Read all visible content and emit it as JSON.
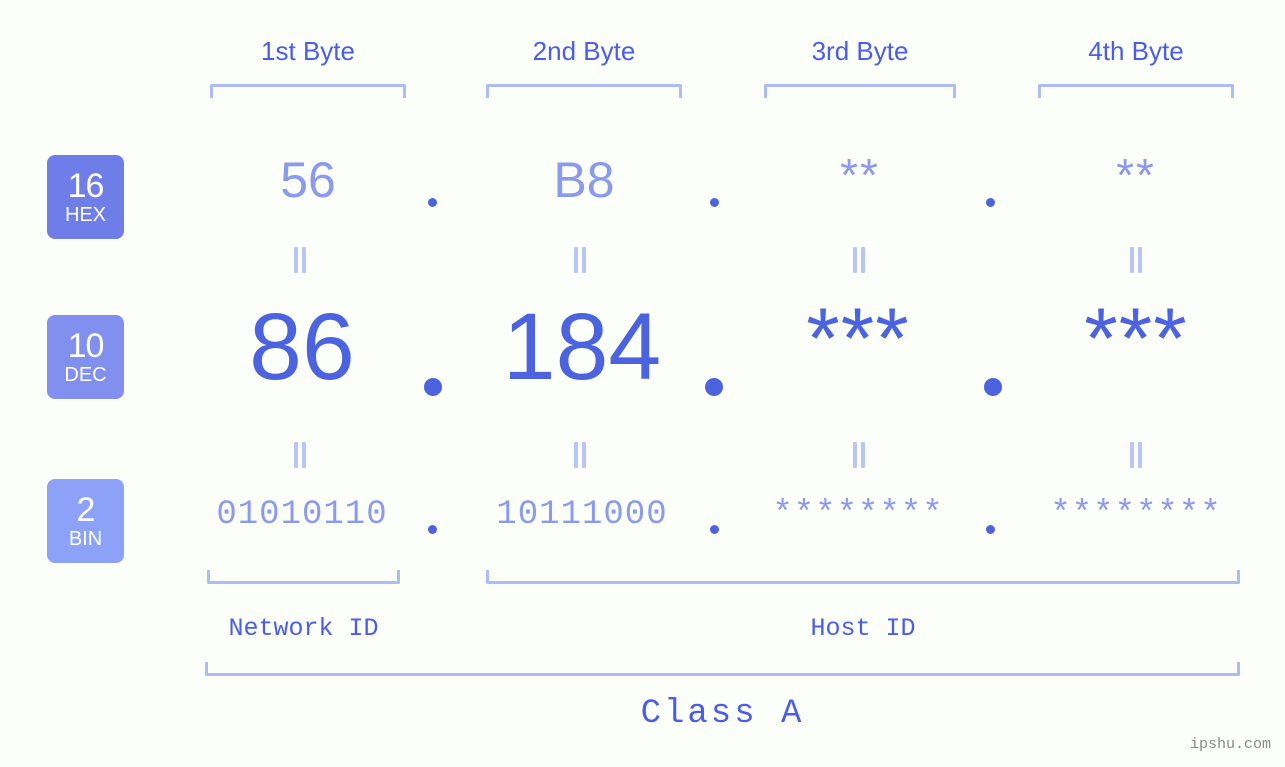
{
  "meta": {
    "watermark": "ipshu.com",
    "background_color": "#fcfef9",
    "accent_color": "#4c63e0",
    "accent_light_color": "#8a9aee",
    "bracket_color": "#aebcf6"
  },
  "byte_headers": [
    {
      "label": "1st Byte"
    },
    {
      "label": "2nd Byte"
    },
    {
      "label": "3rd Byte"
    },
    {
      "label": "4th Byte"
    }
  ],
  "rows": [
    {
      "badge_number": "16",
      "badge_name": "HEX",
      "badge_color": "#6f7de8",
      "values": [
        "56",
        "B8",
        "**",
        "**"
      ],
      "separator": "."
    },
    {
      "badge_number": "10",
      "badge_name": "DEC",
      "badge_color": "#8190ef",
      "values": [
        "86",
        "184",
        "***",
        "***"
      ],
      "separator": "."
    },
    {
      "badge_number": "2",
      "badge_name": "BIN",
      "badge_color": "#8ba2f8",
      "values": [
        "01010110",
        "10111000",
        "********",
        "********"
      ],
      "separator": "."
    }
  ],
  "connectors": {
    "symbol": "equals-rotated"
  },
  "segments": [
    {
      "label": "Network ID"
    },
    {
      "label": "Host ID"
    }
  ],
  "class": {
    "label": "Class A"
  }
}
